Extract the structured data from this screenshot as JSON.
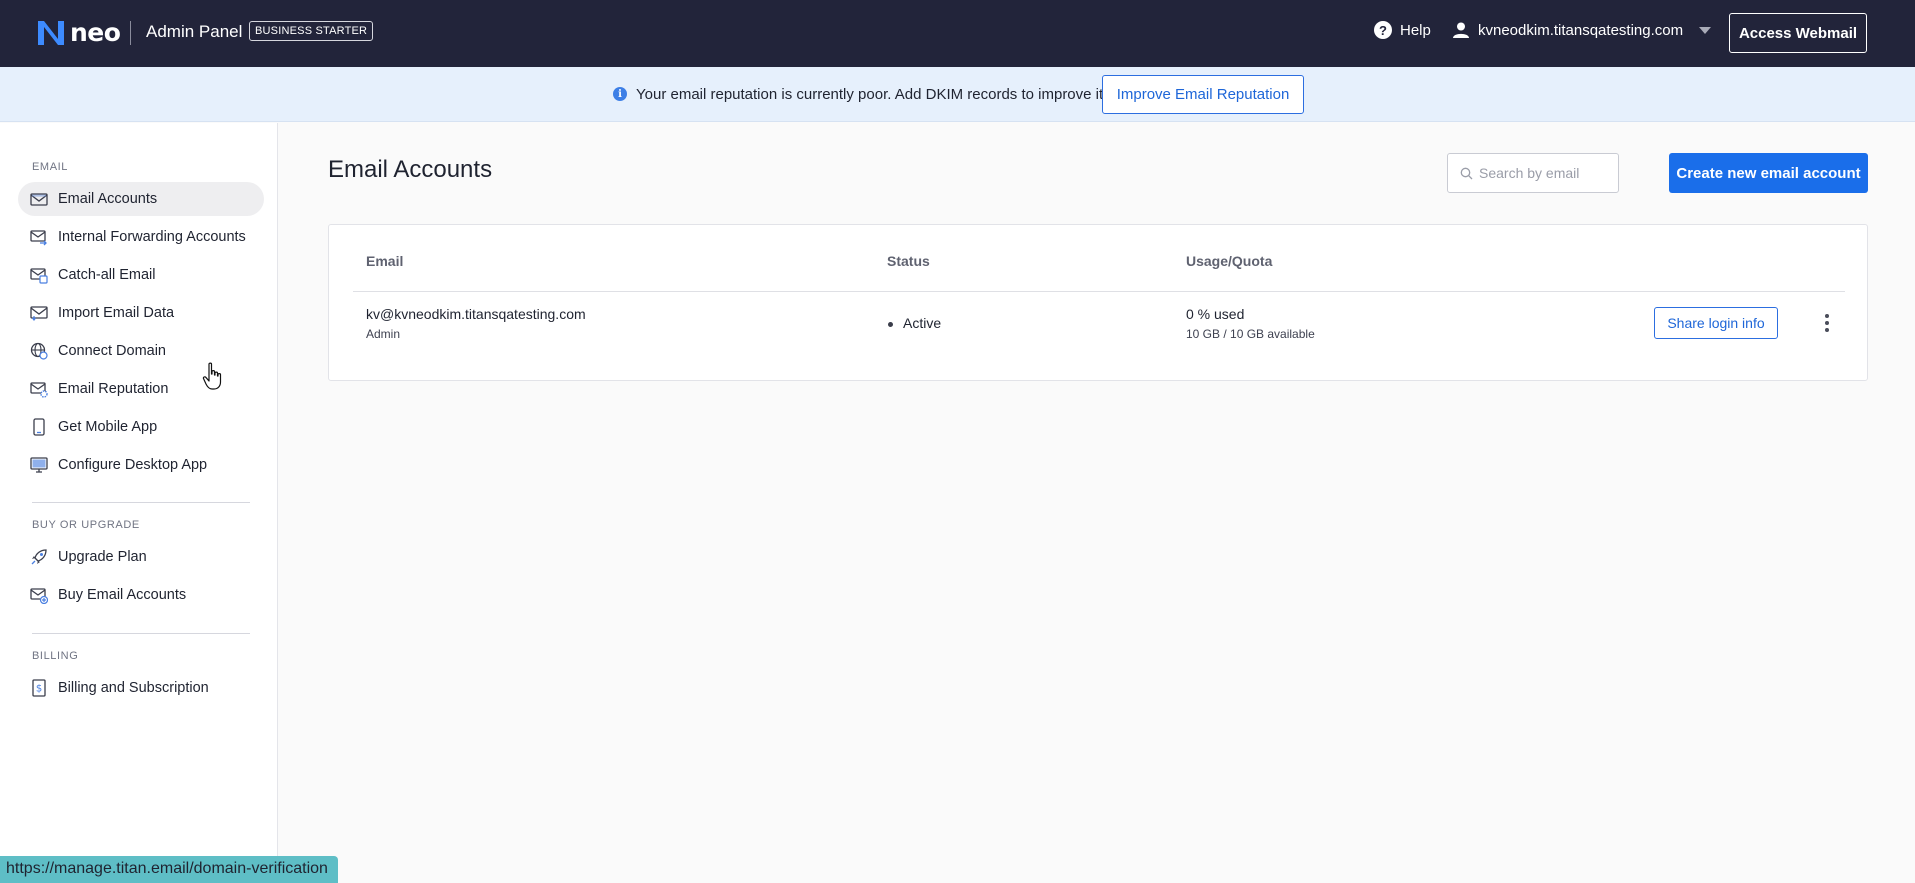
{
  "header": {
    "brand": "neo",
    "title": "Admin Panel",
    "plan_badge": "BUSINESS STARTER",
    "help_label": "Help",
    "account_domain": "kvneodkim.titansqatesting.com",
    "webmail_button": "Access Webmail"
  },
  "banner": {
    "message": "Your email reputation is currently poor. Add DKIM records to improve it.",
    "button": "Improve Email Reputation"
  },
  "sidebar": {
    "sections": [
      {
        "label": "EMAIL"
      },
      {
        "label": "BUY OR UPGRADE"
      },
      {
        "label": "BILLING"
      }
    ],
    "items": [
      {
        "label": "Email Accounts",
        "icon": "mail-icon",
        "active": true
      },
      {
        "label": "Internal Forwarding Accounts",
        "icon": "mail-forward-icon"
      },
      {
        "label": "Catch-all Email",
        "icon": "mail-catchall-icon"
      },
      {
        "label": "Import Email Data",
        "icon": "mail-import-icon"
      },
      {
        "label": "Connect Domain",
        "icon": "globe-icon"
      },
      {
        "label": "Email Reputation",
        "icon": "mail-gear-icon"
      },
      {
        "label": "Get Mobile App",
        "icon": "phone-icon"
      },
      {
        "label": "Configure Desktop App",
        "icon": "monitor-icon"
      },
      {
        "label": "Upgrade Plan",
        "icon": "rocket-icon"
      },
      {
        "label": "Buy Email Accounts",
        "icon": "mail-plus-icon"
      },
      {
        "label": "Billing and Subscription",
        "icon": "invoice-icon"
      }
    ]
  },
  "main": {
    "title": "Email Accounts",
    "search_placeholder": "Search by email",
    "create_button": "Create new email account",
    "table": {
      "columns": [
        "Email",
        "Status",
        "Usage/Quota"
      ],
      "rows": [
        {
          "email": "kv@kvneodkim.titansqatesting.com",
          "role": "Admin",
          "status": "Active",
          "usage": "0 % used",
          "quota": "10 GB / 10 GB available",
          "action": "Share login info"
        }
      ]
    }
  },
  "status_bar": {
    "url": "https://manage.titan.email/domain-verification"
  },
  "colors": {
    "topbar": "#22243a",
    "accent": "#1a6eea",
    "banner_bg": "#e6f0fc",
    "status_url_bg": "#5ebec6"
  }
}
